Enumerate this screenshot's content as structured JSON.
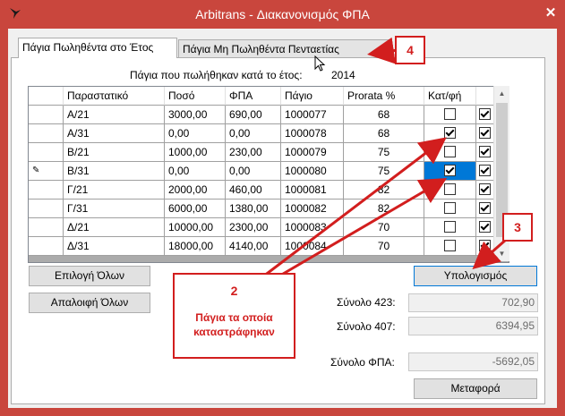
{
  "window": {
    "title": "Arbitrans - Διακανονισμός ΦΠΑ",
    "close_glyph": "✕",
    "colors": {
      "titlebar": "#c9463d",
      "selection": "#0078d7",
      "annotation": "#d21e1e"
    }
  },
  "tabs": [
    {
      "label": "Πάγια Πωληθέντα στο Έτος"
    },
    {
      "label": "Πάγια Μη Πωληθέντα Πενταετίας"
    }
  ],
  "caption": {
    "label": "Πάγια που πωλήθηκαν κατά το έτος:",
    "year": "2014"
  },
  "table": {
    "columns": [
      "Παραστατικό",
      "Ποσό",
      "ΦΠΑ",
      "Πάγιο",
      "Prorata %",
      "Κατ/φή",
      ""
    ],
    "rows": [
      {
        "doc": "Α/21",
        "amount": "3000,00",
        "vat": "690,00",
        "asset": "1000077",
        "prorata": "68",
        "destroyed": false,
        "include": true
      },
      {
        "doc": "Α/31",
        "amount": "0,00",
        "vat": "0,00",
        "asset": "1000078",
        "prorata": "68",
        "destroyed": true,
        "include": true
      },
      {
        "doc": "Β/21",
        "amount": "1000,00",
        "vat": "230,00",
        "asset": "1000079",
        "prorata": "75",
        "destroyed": false,
        "include": true
      },
      {
        "doc": "Β/31",
        "amount": "0,00",
        "vat": "0,00",
        "asset": "1000080",
        "prorata": "75",
        "destroyed": true,
        "include": true,
        "selected": true,
        "editing": true
      },
      {
        "doc": "Γ/21",
        "amount": "2000,00",
        "vat": "460,00",
        "asset": "1000081",
        "prorata": "82",
        "destroyed": false,
        "include": true
      },
      {
        "doc": "Γ/31",
        "amount": "6000,00",
        "vat": "1380,00",
        "asset": "1000082",
        "prorata": "82",
        "destroyed": false,
        "include": true
      },
      {
        "doc": "Δ/21",
        "amount": "10000,00",
        "vat": "2300,00",
        "asset": "1000083",
        "prorata": "70",
        "destroyed": false,
        "include": true
      },
      {
        "doc": "Δ/31",
        "amount": "18000,00",
        "vat": "4140,00",
        "asset": "1000084",
        "prorata": "70",
        "destroyed": false,
        "include": true
      }
    ],
    "row_editing_glyph": "✎"
  },
  "buttons": {
    "select_all": "Επιλογή Όλων",
    "deselect_all": "Απαλοιφή Όλων",
    "calculate": "Υπολογισμός",
    "transfer": "Μεταφορά"
  },
  "totals": {
    "total_423_label": "Σύνολο 423:",
    "total_423_value": "702,90",
    "total_407_label": "Σύνολο 407:",
    "total_407_value": "6394,95",
    "total_vat_label": "Σύνολο ΦΠΑ:",
    "total_vat_value": "-5692,05"
  },
  "annotations": {
    "callout_2_number": "2",
    "callout_2_text": "Πάγια τα οποία καταστράφηκαν",
    "callout_3_number": "3",
    "callout_4_number": "4"
  }
}
